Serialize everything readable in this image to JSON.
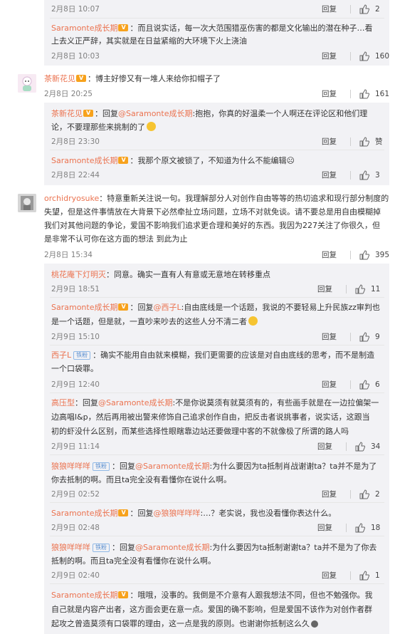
{
  "actions": {
    "reply": "回复",
    "like": "赞"
  },
  "colors": {
    "nick": "#eb7350",
    "nested_bg": "#f2f2f5",
    "meta": "#808080"
  },
  "badges": {
    "fan": "铁粉"
  },
  "icons": [
    "thumb-up-icon",
    "avatar-icon",
    "vip-badge-icon",
    "emoji-icon"
  ],
  "lines": {
    "l1": {
      "date": "2月8日 10:07",
      "likes": "2"
    },
    "l2": {
      "nick": "Saramonte成长期",
      "text1": "：而且说实话，每一次大范围猎巫伤害的都是文化输出的潜在种子…看",
      "text2": "上去义正严辞，其实就是在日益紧缩的大环境下火上浇油",
      "date": "2月8日 10:03",
      "likes": "160"
    },
    "l3": {
      "nick": "茶新花见",
      "text": "：博主好惨又有一堆人来给你扣帽子了",
      "date": "2月8日 20:25",
      "likes": "161"
    },
    "l4": {
      "nick": "茶新花见",
      "pre": "：回复",
      "at": "@Saramonte成长期",
      "text1": ":抱抱，你真的好温柔一个人啊还在评论区和他们理",
      "text2": "论，不要理那些来挑制的了",
      "date": "2月8日 23:30",
      "likes": "赞"
    },
    "l5": {
      "nick": "Saramonte成长期",
      "text": "：我那个原文被锁了，不知道为什么不能编辑☹",
      "date": "2月8日 22:44",
      "likes": "3"
    },
    "l6": {
      "nick": "orchidryosuke",
      "text1": "：特意重新关注说一句。我理解部分人对创作自由等等的热切追求和现行部分制度的",
      "text2": "失望，但是这件事情放在大背景下必然牵扯立场问题，立场不对就免谈。请不要总是用自由模糊掉",
      "text3": "我们对其他问题的争论，爱国不影响我们追求更合理和美好的东西。我因为227关注了你很久，但",
      "text4": "是非常不认可你在这方面的想法 到此为止",
      "date": "2月8日 15:34",
      "likes": "395"
    },
    "l7": {
      "nick": "桃花庵下灯明灭",
      "text": "：同意。确实一直有人有意或无意地在转移重点",
      "date": "2月9日 18:51",
      "likes": "11"
    },
    "l8": {
      "nick": "Saramonte成长期",
      "pre": "：回复",
      "at": "@西子L",
      "text1": ":自由底线是一个话题，我说的不要轻易上升民族zz审判也",
      "text2": "是一个话题，但是就，一直吵来吵去的这些人分不清二者",
      "date": "2月9日 15:10",
      "likes": "9"
    },
    "l9": {
      "nick": "西子L",
      "text1": "：确实不能用自由就来模糊，我们更需要的应该是对自由底线的思考，而不是制造",
      "text2": "一个口袋罪。",
      "date": "2月9日 12:40",
      "likes": "6"
    },
    "l10": {
      "nick": "高压型",
      "pre": "：回复",
      "at": "@Saramonte成长期",
      "text1": ":不是你说莫须有就莫须有的，有些画手就是在一边拉偏架一",
      "text2": "边高唱l&p，然后再用被出警来修饰自己追求创作自由，把反击者说挑事者，说实话，这跟当",
      "text3": "初的虾没什么区别，而某些选择性眼瞎靠边站还要做理中客的不就像极了所谓的路人吗",
      "date": "2月9日 11:14",
      "likes": "34"
    },
    "l11": {
      "nick": "狼狼咩咩咩",
      "pre": "：回复",
      "at": "@Saramonte成长期",
      "text1": ":为什么要因为ta抵制肖战谢谢ta？ta并不是为了",
      "text2": "你去抵制的啊。而且ta完全没有看懂你在说什么啊。",
      "date": "2月9日 02:52",
      "likes": "2"
    },
    "l12": {
      "nick": "Saramonte成长期",
      "pre": "：回复",
      "at": "@狼狼咩咩咩",
      "text": ":…？老实说，我也没看懂你表达什么。",
      "date": "2月9日 02:48",
      "likes": "18"
    },
    "l13": {
      "nick": "狼狼咩咩咩",
      "pre": "：回复",
      "at": "@Saramonte成长期",
      "text1": ":为什么要因为ta抵制谢谢ta？ta并不是为了你去",
      "text2": "抵制的啊。而且ta完全没有看懂你在说什么啊。",
      "date": "2月9日 02:40",
      "likes": "1"
    },
    "l14": {
      "nick": "Saramonte成长期",
      "text1": "：哦哦，没事的。我倒是不介意有人跟我想法不同，但也不勉强你。我",
      "text2": "自己就是内容产出者，这方面会更在意一点。爱国的确不影响，但是爱国不该作为对创作者群",
      "text3": "起攻之曾造莫须有口袋罪的理由，这一点是我的原则。也谢谢你抵制这么久"
    }
  }
}
